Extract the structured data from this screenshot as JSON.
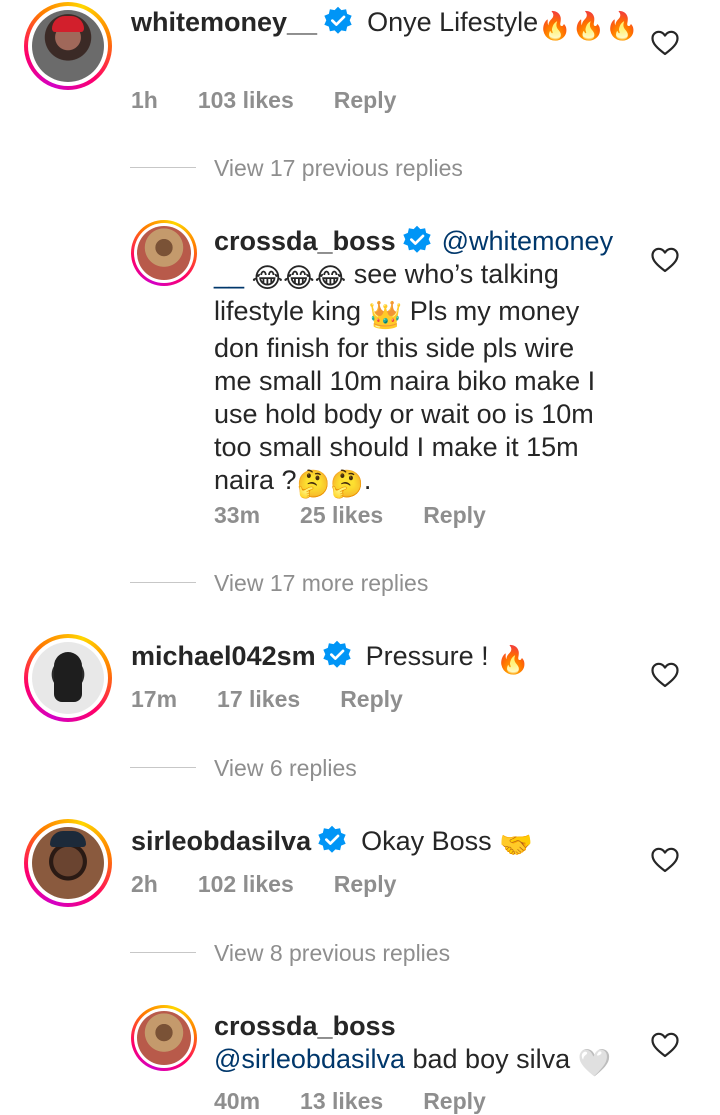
{
  "comments": [
    {
      "username": "whitemoney__",
      "text": "Onye Lifestyle",
      "emoji_trail": "🔥🔥🔥",
      "time": "1h",
      "likes": "103 likes",
      "reply": "Reply"
    },
    {
      "username": "crossda_boss",
      "mention": "@whitemoney",
      "mention_cont": "__",
      "emoji_laugh": "😂😂😂",
      "text_l1": " see who’s talking",
      "text_l2a": "lifestyle king",
      "emoji_crown": "👑",
      "text_l2b": " Pls my money",
      "text_l3": "don finish for this side pls wire",
      "text_l4": "me small 10m naira biko make I",
      "text_l5": "use hold body or wait oo  is 10m",
      "text_l6": "too small should I make it 15m",
      "text_l7": "naira ?",
      "emoji_think": "🤔🤔",
      "text_end": ".",
      "time": "33m",
      "likes": "25 likes",
      "reply": "Reply"
    },
    {
      "username": "michael042sm",
      "text": "Pressure !",
      "emoji_trail": "🔥",
      "time": "17m",
      "likes": "17 likes",
      "reply": "Reply"
    },
    {
      "username": "sirleobdasilva",
      "text": "Okay Boss",
      "emoji_trail": "🤝",
      "time": "2h",
      "likes": "102 likes",
      "reply": "Reply"
    },
    {
      "username": "crossda_boss",
      "mention": "@sirleobdasilva",
      "text": " bad boy silva",
      "emoji_trail": "🤍",
      "time": "40m",
      "likes": "13 likes",
      "reply": "Reply"
    }
  ],
  "view_replies": [
    "View 17 previous replies",
    "View 17 more replies",
    "View 6 replies",
    "View 8 previous replies"
  ],
  "colors": {
    "text": "#262626",
    "meta": "#8e8e8e",
    "mention": "#00376b",
    "verified": "#0095f6"
  }
}
